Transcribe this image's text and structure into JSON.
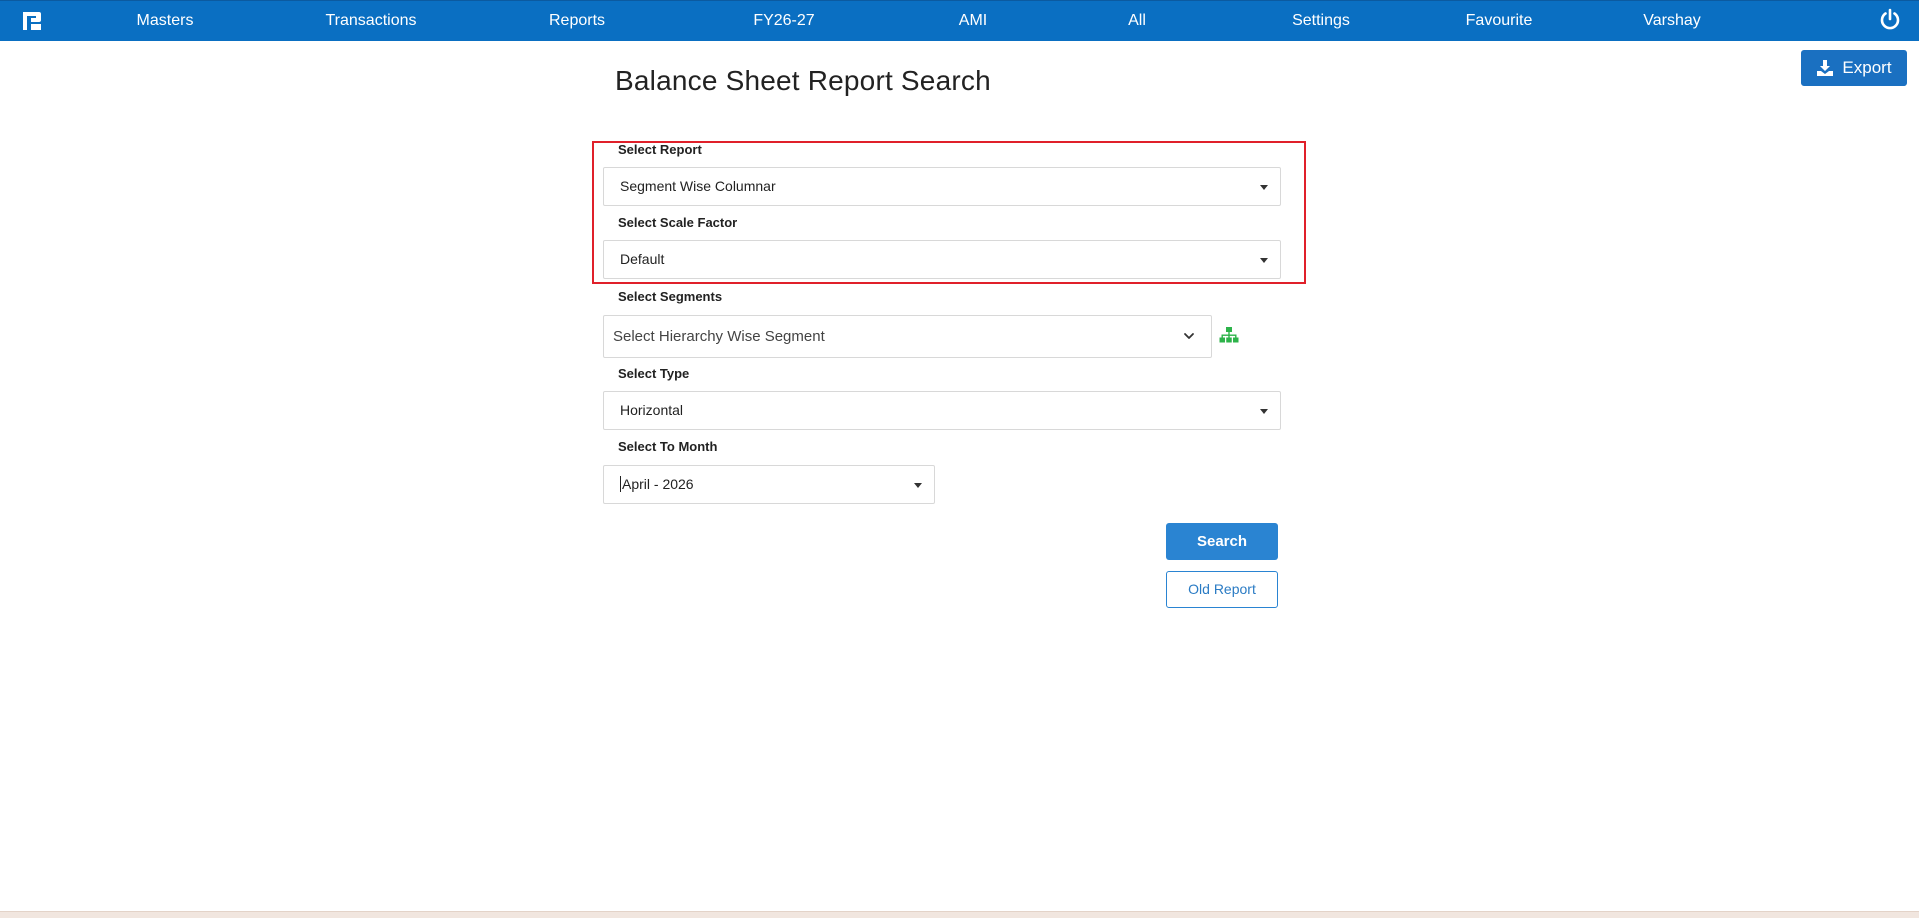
{
  "nav": {
    "items": [
      "Masters",
      "Transactions",
      "Reports",
      "FY26-27",
      "AMI",
      "All",
      "Settings",
      "Favourite",
      "Varshay"
    ]
  },
  "toolbar": {
    "export_label": "Export"
  },
  "page": {
    "title": "Balance Sheet Report Search"
  },
  "form": {
    "report_label": "Select Report",
    "report_value": "Segment Wise Columnar",
    "scale_label": "Select Scale Factor",
    "scale_value": "Default",
    "segments_label": "Select Segments",
    "segments_placeholder": "Select Hierarchy Wise Segment",
    "type_label": "Select Type",
    "type_value": "Horizontal",
    "month_label": "Select To Month",
    "month_value": "April - 2026"
  },
  "actions": {
    "search_label": "Search",
    "old_report_label": "Old Report"
  },
  "colors": {
    "nav_bg": "#0a6fc2",
    "primary": "#2a84d2",
    "highlight": "#e0202a",
    "hierarchy_icon": "#2db34a"
  },
  "icons": {
    "logo": "app-logo",
    "power": "power-icon",
    "export": "download-icon",
    "hierarchy": "sitemap-icon"
  }
}
